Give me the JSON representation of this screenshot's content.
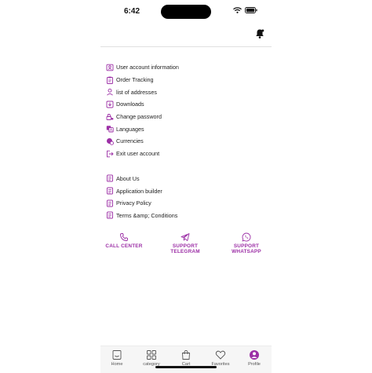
{
  "status_bar": {
    "time": "6:42"
  },
  "menu": {
    "account_items": [
      {
        "label": "User account information",
        "icon": "user-card-icon"
      },
      {
        "label": "Order Tracking",
        "icon": "clipboard-icon"
      },
      {
        "label": "list of addresses",
        "icon": "person-pin-icon"
      },
      {
        "label": "Downloads",
        "icon": "download-icon"
      },
      {
        "label": "Change password",
        "icon": "key-icon"
      },
      {
        "label": "Languages",
        "icon": "language-icon"
      },
      {
        "label": "Currencies",
        "icon": "currency-icon"
      },
      {
        "label": "Exit user account",
        "icon": "exit-icon"
      }
    ],
    "info_items": [
      {
        "label": "About Us",
        "icon": "document-icon"
      },
      {
        "label": "Application builder",
        "icon": "document-icon"
      },
      {
        "label": "Privacy Policy",
        "icon": "document-icon"
      },
      {
        "label": "Terms &amp; Conditions",
        "icon": "document-icon"
      }
    ]
  },
  "support": {
    "call_center": "CALL CENTER",
    "telegram": [
      "SUPPORT",
      "TELEGRAM"
    ],
    "whatsapp": [
      "SUPPORT",
      "WHATSAPP"
    ]
  },
  "tabbar": {
    "tabs": [
      {
        "label": "Home",
        "icon": "home-icon"
      },
      {
        "label": "category",
        "icon": "grid-icon"
      },
      {
        "label": "Cart",
        "icon": "cart-icon"
      },
      {
        "label": "Favorites",
        "icon": "heart-icon"
      },
      {
        "label": "Profile",
        "icon": "profile-icon"
      }
    ],
    "active": "Profile"
  },
  "colors": {
    "accent": "#9c2fa6",
    "text": "#222222"
  }
}
